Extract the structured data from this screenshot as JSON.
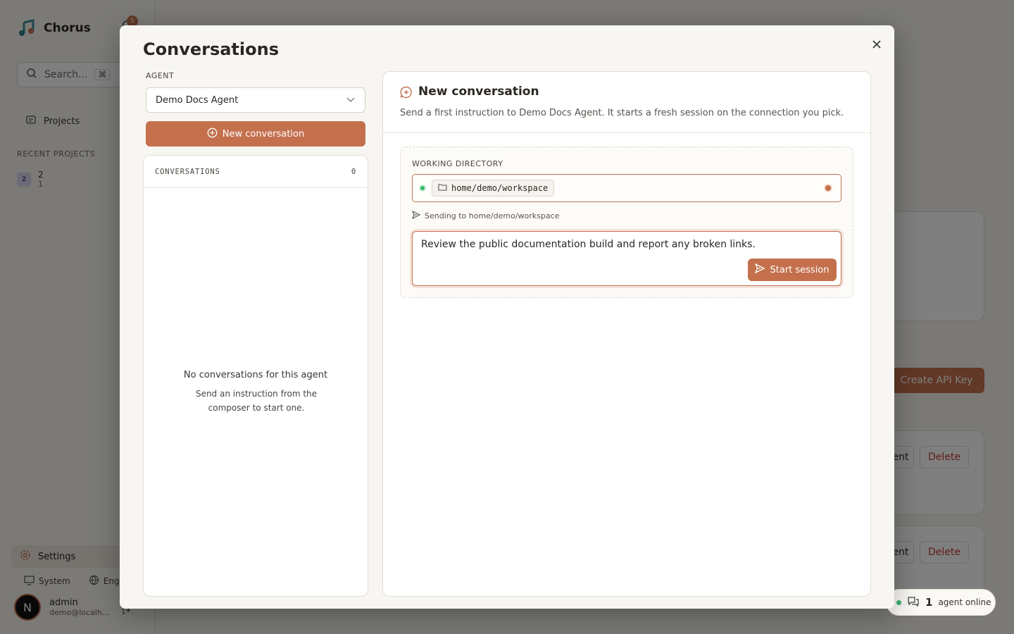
{
  "app": {
    "name": "Chorus",
    "notification_count": "5",
    "search_placeholder": "Search...",
    "search_shortcut": "⌘",
    "nav_projects": "Projects",
    "recent_projects_title": "RECENT PROJECTS",
    "recent_project": {
      "avatar": "2",
      "name": "2",
      "sub": "1"
    },
    "settings": "Settings",
    "theme": "System",
    "language": "Eng",
    "user": {
      "avatar": "N",
      "name": "admin",
      "email": "demo@localh..."
    },
    "background": {
      "create_api_key": "Create API Key",
      "agent_button_partial": "ent",
      "delete": "Delete"
    },
    "online": {
      "count": "1",
      "label": "agent online"
    }
  },
  "modal": {
    "title": "Conversations",
    "agent_label": "AGENT",
    "agent_selected": "Demo Docs Agent",
    "new_conversation_button": "New conversation",
    "list": {
      "header": "CONVERSATIONS",
      "count": "0",
      "empty_title": "No conversations for this agent",
      "empty_desc": "Send an instruction from the composer to start one."
    },
    "panel": {
      "title": "New conversation",
      "description": "Send a first instruction to Demo Docs Agent. It starts a fresh session on the connection you pick.",
      "working_directory_label": "WORKING DIRECTORY",
      "working_directory": "home/demo/workspace",
      "sending_to": "Sending to home/demo/workspace",
      "message": "Review the public documentation build and report any broken links.",
      "start_button": "Start session"
    }
  },
  "colors": {
    "accent": "#c4704d",
    "online": "#2fb865",
    "danger": "#c0392b"
  }
}
